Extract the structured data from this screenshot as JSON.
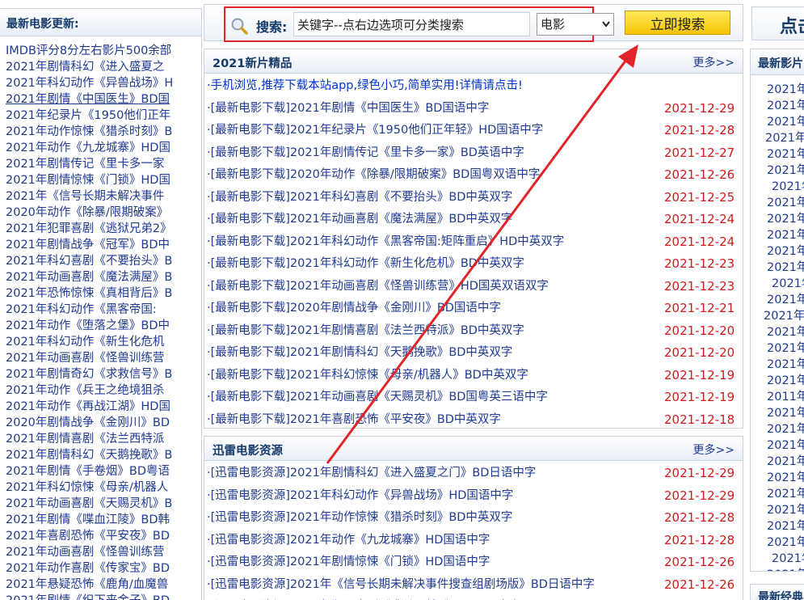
{
  "left_panel": {
    "header": "最新电影更新:",
    "items": [
      "IMDB评分8分左右影片500余部",
      "2021年剧情科幻《进入盛夏之",
      "2021年科幻动作《异兽战场》H",
      "2021年剧情《中国医生》BD国",
      "2021年纪录片《1950他们正年",
      "2021年动作惊悚《猎杀时刻》B",
      "2021年动作《九龙城寨》HD国",
      "2021年剧情传记《里卡多一家",
      "2021年剧情惊悚《门锁》HD国",
      "2021年《信号长期未解决事件",
      "2020年动作《除暴/限期破案》",
      "2021年犯罪喜剧《逃狱兄弟2》",
      "2021年剧情战争《冠军》BD中",
      "2021年科幻喜剧《不要抬头》B",
      "2021年动画喜剧《魔法满屋》B",
      "2021年恐怖惊悚《真相背后》B",
      "2021年科幻动作《黑客帝国:",
      "2021年动作《堕落之堡》BD中",
      "2021年科幻动作《新生化危机",
      "2021年动画喜剧《怪兽训练营",
      "2021年剧情奇幻《求救信号》B",
      "2021年动作《兵王之绝境狙杀",
      "2021年动作《再战江湖》HD国",
      "2020年剧情战争《金刚川》BD",
      "2021年剧情喜剧《法兰西特派",
      "2021年剧情科幻《天鹅挽歌》B",
      "2021年剧情《手卷烟》BD粤语",
      "2021年科幻惊悚《母亲/机器人",
      "2021年动画喜剧《天赐灵机》B",
      "2021年剧情《喋血江陵》BD韩",
      "2021年喜剧恐怖《平安夜》BD",
      "2021年动画喜剧《怪兽训练营",
      "2021年动作喜剧《传家宝》BD",
      "2021年悬疑恐怖《鹿角/血魔兽",
      "2021年剧情《织下来金子》BD"
    ]
  },
  "search": {
    "label": "搜索:",
    "value": "关键字--点右边选项可分类搜索",
    "category": "电影",
    "button": "立即搜索"
  },
  "box_new": {
    "title": "2021新片精品",
    "more": "更多>>",
    "notice": "·手机浏览,推荐下载本站app,绿色小巧,简单实用!详情请点击!",
    "items": [
      {
        "title": "[最新电影下载]2021年剧情《中国医生》BD国语中字",
        "date": "2021-12-29"
      },
      {
        "title": "[最新电影下载]2021年纪录片《1950他们正年轻》HD国语中字",
        "date": "2021-12-28"
      },
      {
        "title": "[最新电影下载]2021年剧情传记《里卡多一家》BD英语中字",
        "date": "2021-12-27"
      },
      {
        "title": "[最新电影下载]2020年动作《除暴/限期破案》BD国粤双语中字",
        "date": "2021-12-26"
      },
      {
        "title": "[最新电影下载]2021年科幻喜剧《不要抬头》BD中英双字",
        "date": "2021-12-25"
      },
      {
        "title": "[最新电影下载]2021年动画喜剧《魔法满屋》BD中英双字",
        "date": "2021-12-24"
      },
      {
        "title": "[最新电影下载]2021年科幻动作《黑客帝国:矩阵重启》HD中英双字",
        "date": "2021-12-24"
      },
      {
        "title": "[最新电影下载]2021年科幻动作《新生化危机》BD中英双字",
        "date": "2021-12-23"
      },
      {
        "title": "[最新电影下载]2021年动画喜剧《怪兽训练营》HD国英双语双字",
        "date": "2021-12-23"
      },
      {
        "title": "[最新电影下载]2020年剧情战争《金刚川》BD国语中字",
        "date": "2021-12-21"
      },
      {
        "title": "[最新电影下载]2021年剧情喜剧《法兰西特派》BD中英双字",
        "date": "2021-12-20"
      },
      {
        "title": "[最新电影下载]2021年剧情科幻《天鹅挽歌》BD中英双字",
        "date": "2021-12-20"
      },
      {
        "title": "[最新电影下载]2021年科幻惊悚《母亲/机器人》BD中英双字",
        "date": "2021-12-19"
      },
      {
        "title": "[最新电影下载]2021年动画喜剧《天赐灵机》BD国粤英三语中字",
        "date": "2021-12-19"
      },
      {
        "title": "[最新电影下载]2021年喜剧恐怖《平安夜》BD中英双字",
        "date": "2021-12-18"
      }
    ]
  },
  "box_thunder": {
    "title": "迅雷电影资源",
    "more": "更多>>",
    "items": [
      {
        "title": "[迅雷电影资源]2021年剧情科幻《进入盛夏之门》BD日语中字",
        "date": "2021-12-29"
      },
      {
        "title": "[迅雷电影资源]2021年科幻动作《异兽战场》HD国语中字",
        "date": "2021-12-29"
      },
      {
        "title": "[迅雷电影资源]2021年动作惊悚《猎杀时刻》BD中英双字",
        "date": "2021-12-28"
      },
      {
        "title": "[迅雷电影资源]2021年动作《九龙城寨》HD国语中字",
        "date": "2021-12-28"
      },
      {
        "title": "[迅雷电影资源]2021年剧情惊悚《门锁》HD国语中字",
        "date": "2021-12-26"
      },
      {
        "title": "[迅雷电影资源]2021年《信号长期未解决事件搜查组剧场版》BD日语中字",
        "date": "2021-12-26"
      },
      {
        "title": "[迅雷电影资源]2021年犯罪喜剧《逃狱兄弟2》HD国语中字",
        "date": "2021-12-25"
      }
    ]
  },
  "right_panel": {
    "top_text": "点击",
    "header": "最新影片",
    "items": [
      "2021年",
      "2021年",
      "2021年",
      "2021年",
      "2021年",
      "2021年",
      "2021年",
      "2021年",
      "2021年",
      "2021年",
      "2021年",
      "2021年",
      "2021年",
      "2021年",
      "2021年",
      "2021年",
      "2021年",
      "2021年",
      "2021年",
      "2011年",
      "2021年",
      "2021年",
      "2021年",
      "2021年",
      "2021年",
      "2021年",
      "2021年",
      "2021年",
      "2021年",
      "2021年",
      "2021年"
    ],
    "bottom_header": "最新经典"
  },
  "colors": {
    "link": "#1f3a93",
    "date": "#d11a1a",
    "annotation": "#e0242a",
    "button": "#f5c400"
  }
}
